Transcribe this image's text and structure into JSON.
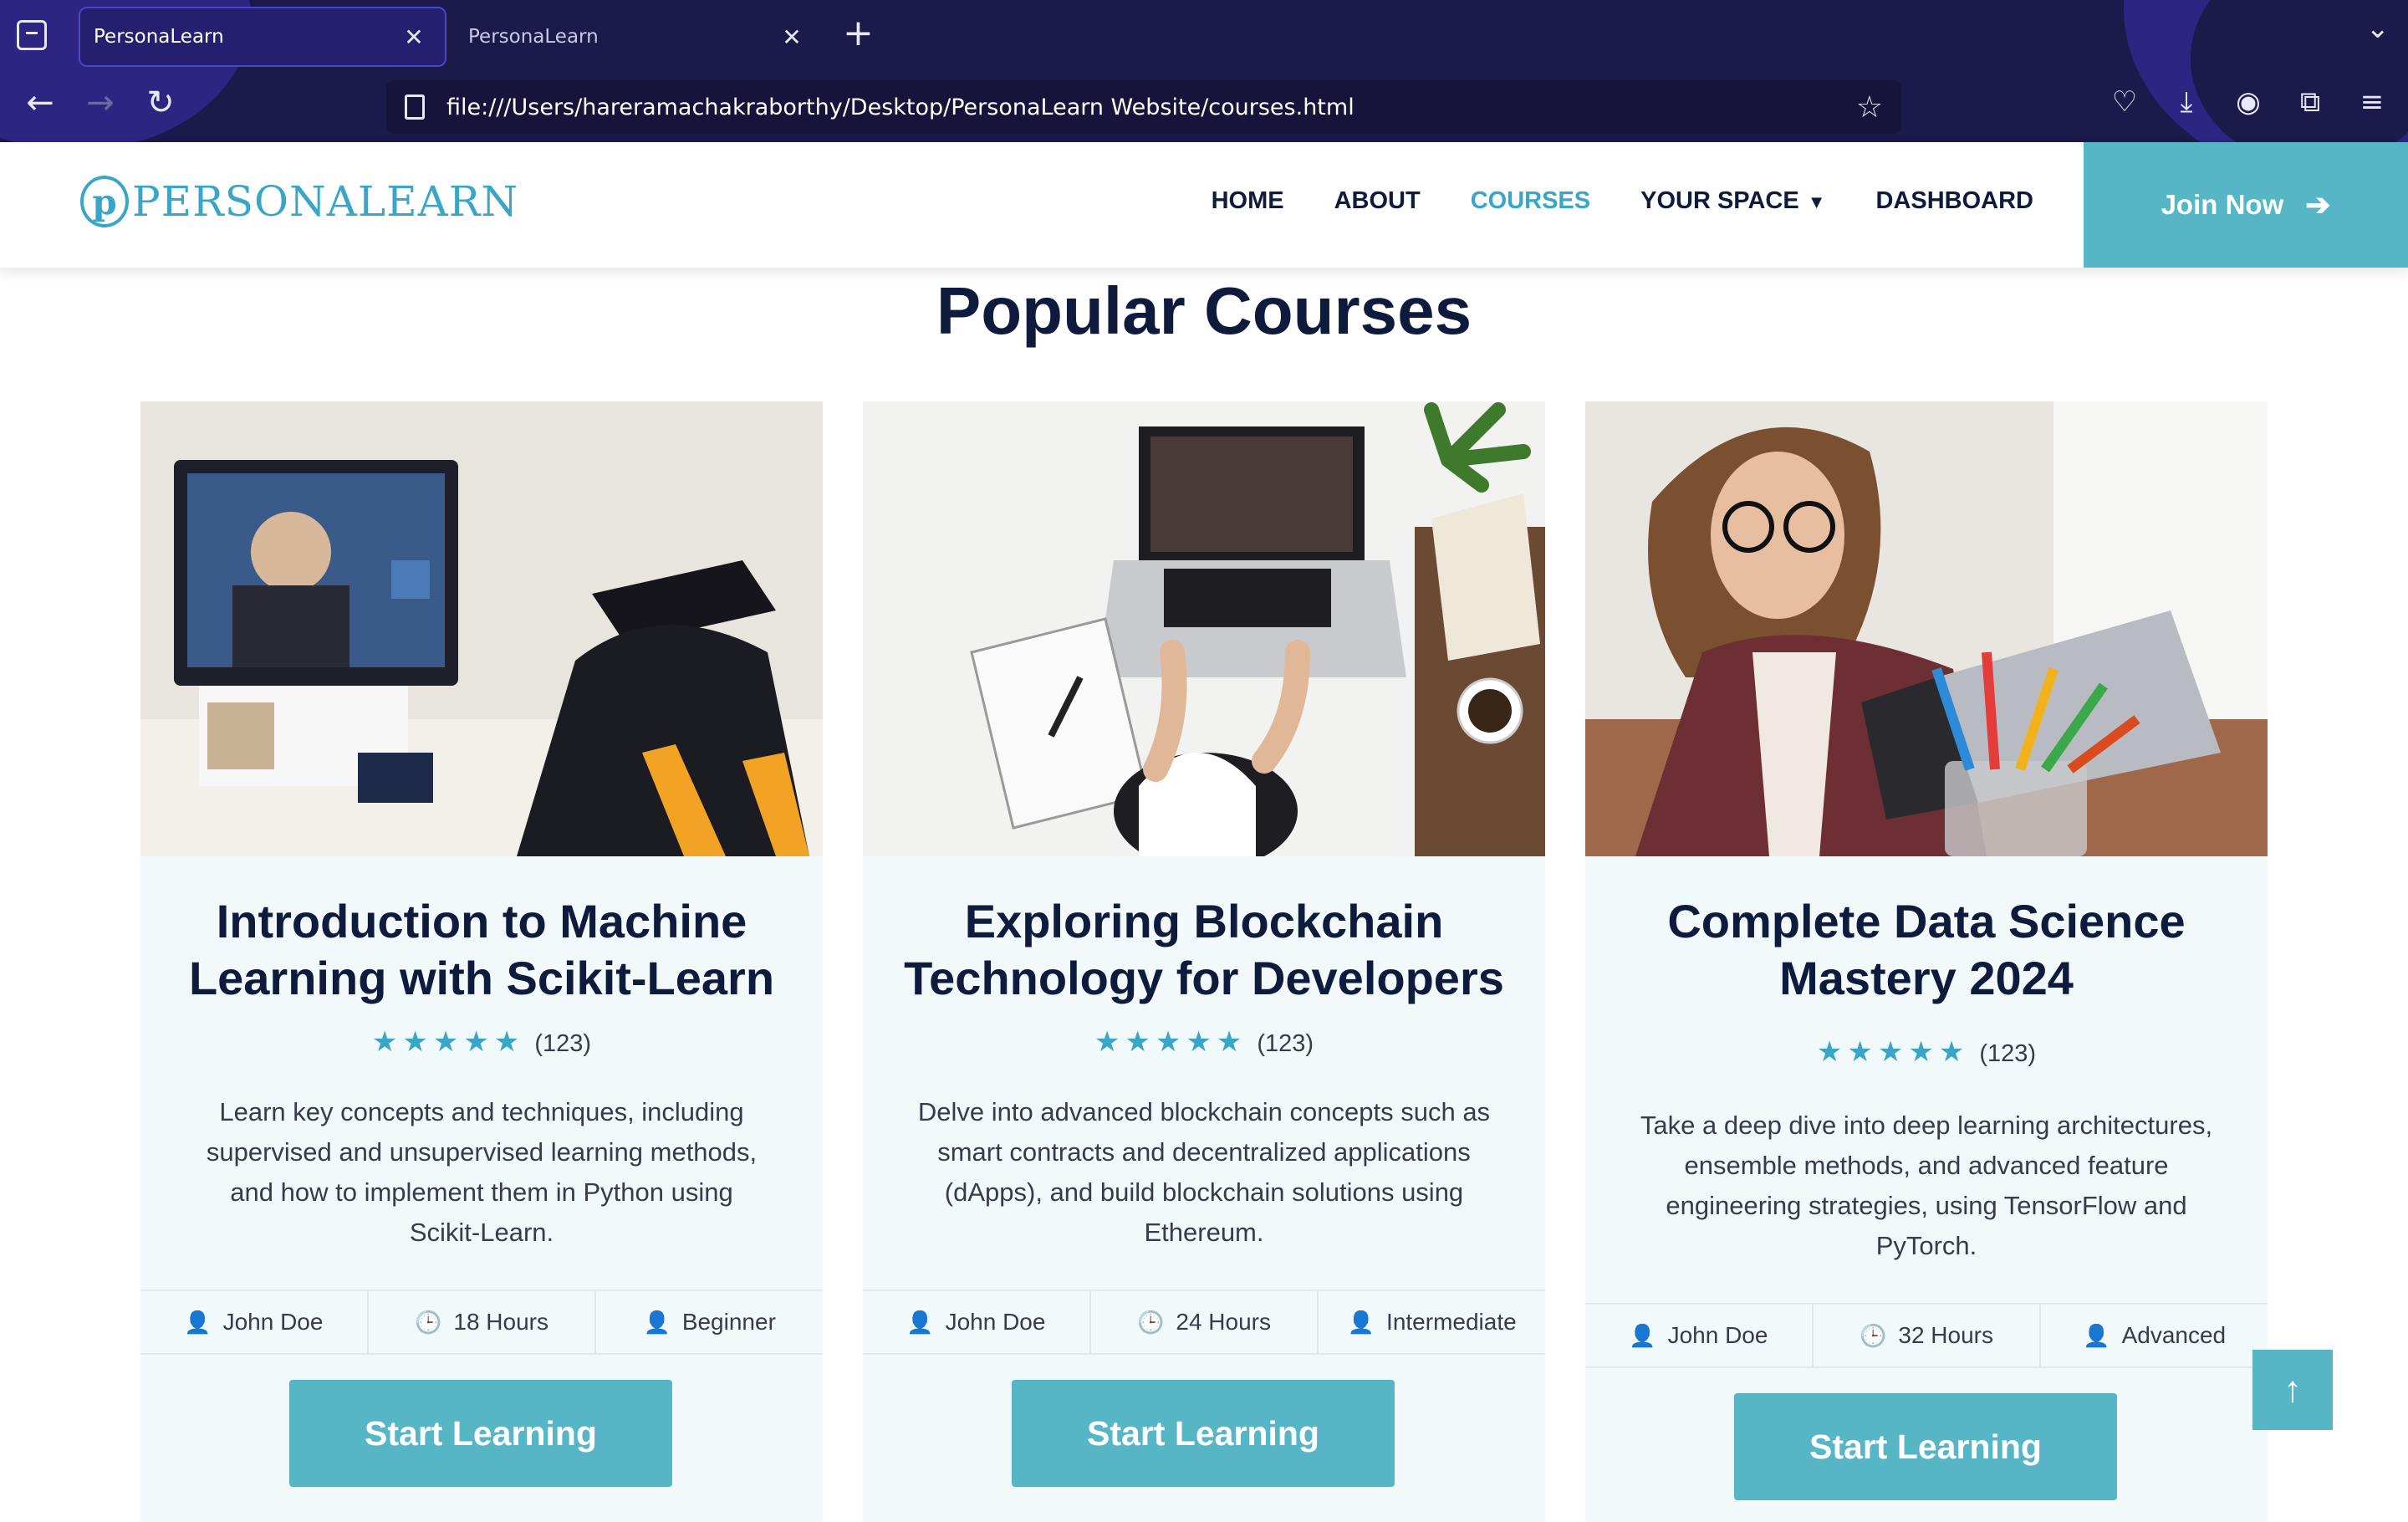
{
  "browser": {
    "tabs": [
      {
        "title": "PersonaLearn"
      },
      {
        "title": "PersonaLearn"
      }
    ],
    "url": "file:///Users/hareramachakraborthy/Desktop/PersonaLearn Website/courses.html"
  },
  "site": {
    "logo_text": "PERSONALEARN",
    "menu": [
      "HOME",
      "ABOUT",
      "COURSES",
      "YOUR SPACE",
      "DASHBOARD"
    ],
    "join_label": "Join Now"
  },
  "section_title": "Popular Courses",
  "courses": [
    {
      "title": "Introduction to Machine Learning with Scikit-Learn",
      "rating_count": "(123)",
      "description": "Learn key concepts and techniques, including supervised and unsupervised learning methods, and how to implement them in Python using Scikit-Learn.",
      "instructor": "John Doe",
      "duration": "18 Hours",
      "level": "Beginner",
      "button": "Start Learning"
    },
    {
      "title": "Exploring Blockchain Technology for Developers",
      "rating_count": "(123)",
      "description": "Delve into advanced blockchain concepts such as smart contracts and decentralized applications (dApps), and build blockchain solutions using Ethereum.",
      "instructor": "John Doe",
      "duration": "24 Hours",
      "level": "Intermediate",
      "button": "Start Learning"
    },
    {
      "title": "Complete Data Science Mastery 2024",
      "rating_count": "(123)",
      "description": "Take a deep dive into deep learning architectures, ensemble methods, and advanced feature engineering strategies, using TensorFlow and PyTorch.",
      "instructor": "John Doe",
      "duration": "32 Hours",
      "level": "Advanced",
      "button": "Start Learning"
    }
  ],
  "colors": {
    "accent": "#56b6c6",
    "heading": "#0f1b3d",
    "chrome": "#1c1a4a"
  },
  "icons": {
    "instructor": "user-icon",
    "duration": "clock-icon",
    "level": "person-icon",
    "rating": "star-icon",
    "back_to_top": "arrow-up-icon"
  }
}
